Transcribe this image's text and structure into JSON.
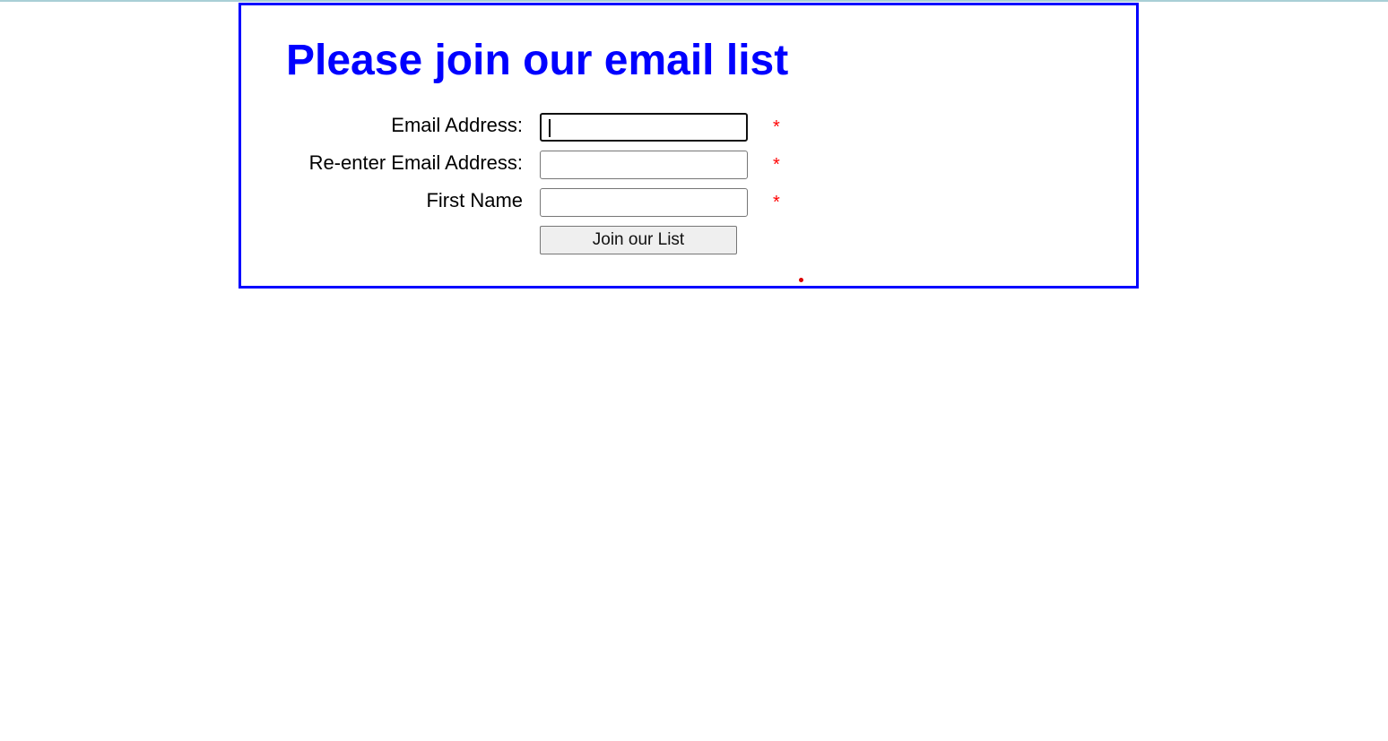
{
  "colors": {
    "title": "#0000ff",
    "border": "#0000ff",
    "required": "#ff0000",
    "button_bg": "#efefef"
  },
  "form": {
    "title": "Please join our email list",
    "fields": [
      {
        "label": "Email Address:",
        "value": "",
        "required_mark": "*",
        "focused": true
      },
      {
        "label": "Re-enter Email Address:",
        "value": "",
        "required_mark": "*",
        "focused": false
      },
      {
        "label": "First Name",
        "value": "",
        "required_mark": "*",
        "focused": false
      }
    ],
    "submit_label": "Join our List"
  }
}
